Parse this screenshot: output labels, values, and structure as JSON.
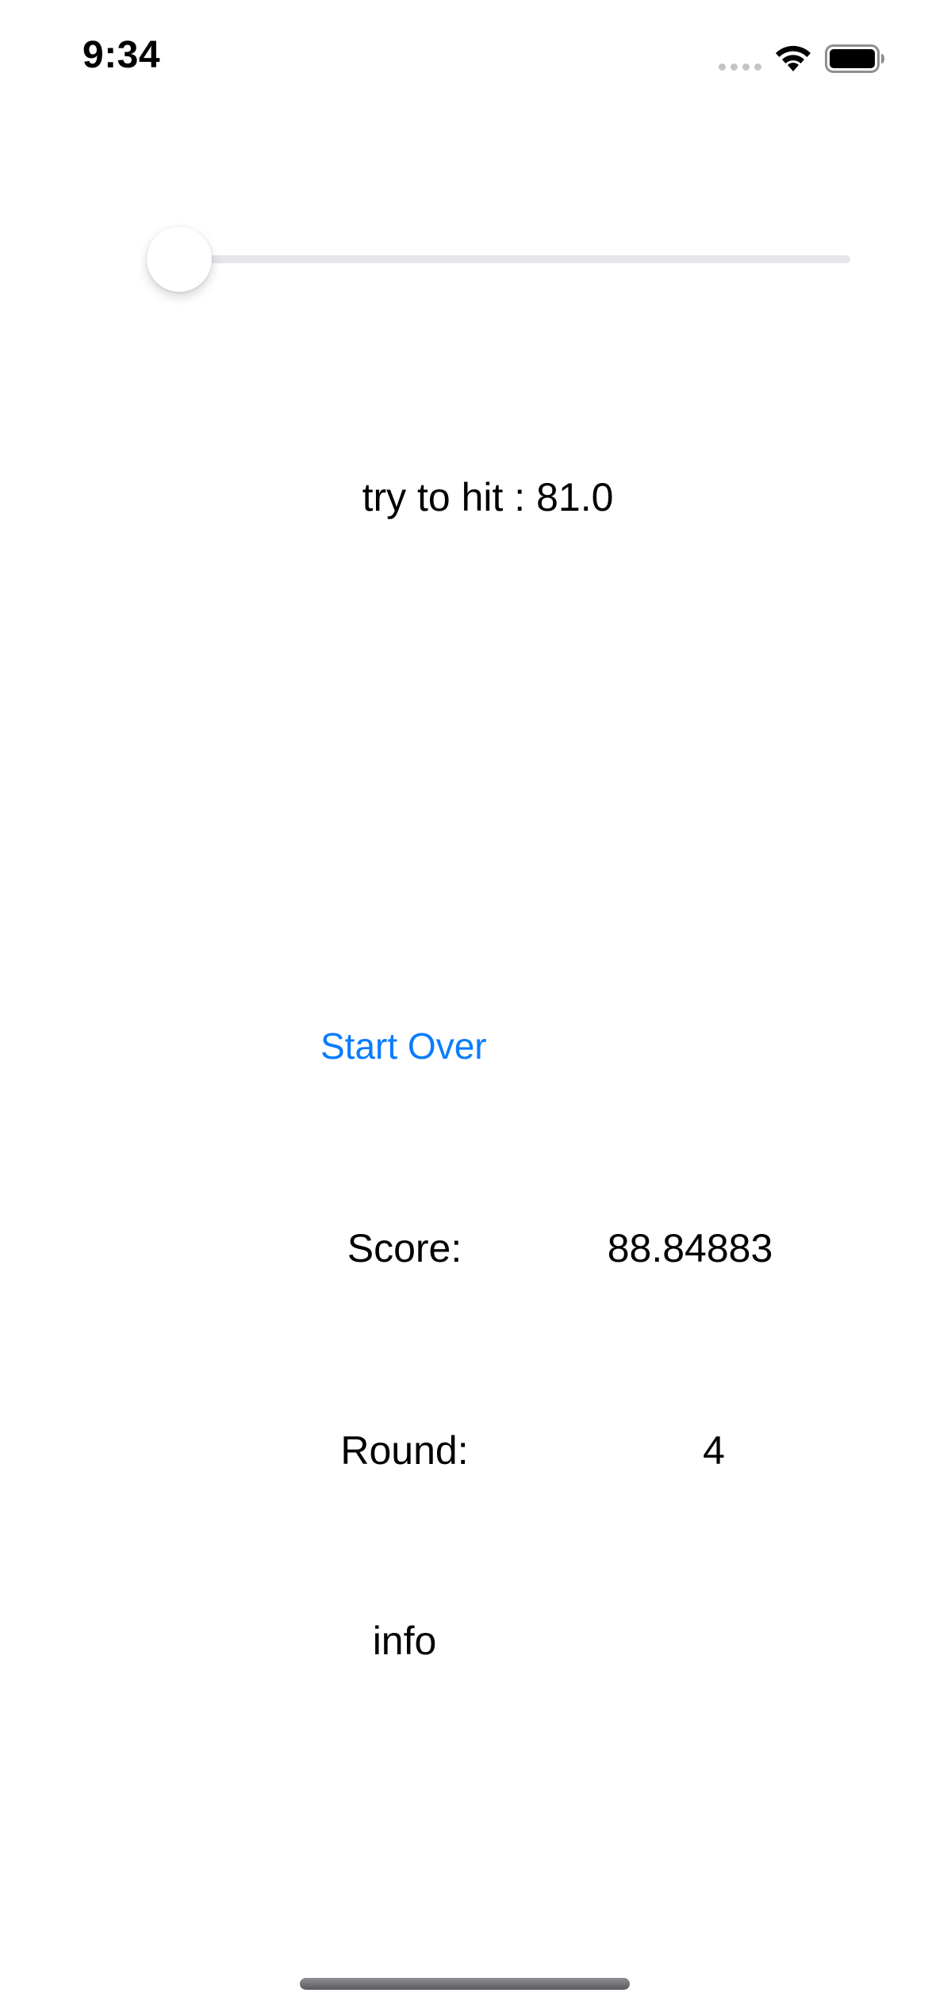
{
  "status_bar": {
    "time": "9:34",
    "icons": [
      "cellular-signal-icon",
      "wifi-icon",
      "battery-icon"
    ]
  },
  "slider": {
    "min": 0,
    "max": 100,
    "value": 0,
    "accent_color": "#0a7cff"
  },
  "game": {
    "target_text": "try to hit : 81.0",
    "start_over_label": "Start Over",
    "score_label": "Score:",
    "score_value": "88.84883",
    "round_label": "Round:",
    "round_value": "4",
    "info_label": "info"
  },
  "colors": {
    "link_blue": "#0a7cff",
    "track_gray": "#e5e5ea",
    "background": "#ffffff"
  }
}
